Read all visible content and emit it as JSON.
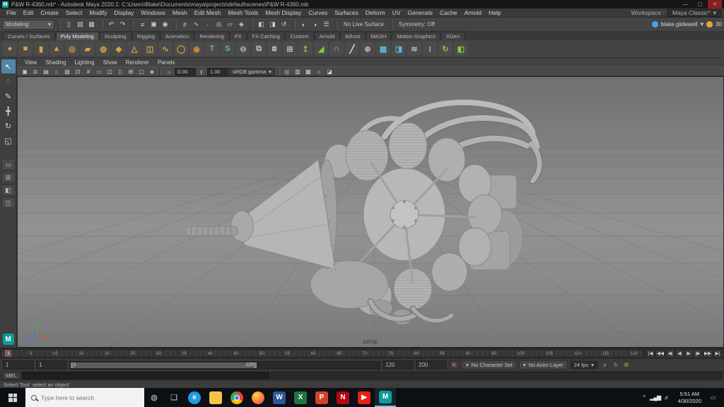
{
  "titlebar": {
    "logo": "M",
    "title": "P&W R-4360.mb* - Autodesk Maya 2020.1: C:\\Users\\Blake\\Documents\\maya\\projects\\default\\scenes\\P&W R-4360.mb",
    "min": "—",
    "max": "▢",
    "close": "✕"
  },
  "menubar": {
    "items": [
      "File",
      "Edit",
      "Create",
      "Select",
      "Modify",
      "Display",
      "Windows",
      "Mesh",
      "Edit Mesh",
      "Mesh Tools",
      "Mesh Display",
      "Curves",
      "Surfaces",
      "Deform",
      "UV",
      "Generate",
      "Cache",
      "Arnold",
      "Help"
    ],
    "workspace_label": "Workspace :",
    "workspace_value": "Maya Classic*",
    "caret": "▾"
  },
  "statusline": {
    "mode": "Modeling",
    "caret": "▾",
    "files": [
      {
        "name": "new-scene-icon",
        "glyph": "▯"
      },
      {
        "name": "open-scene-icon",
        "glyph": "▤"
      },
      {
        "name": "save-scene-icon",
        "glyph": "▦"
      }
    ],
    "undo": [
      {
        "name": "undo-icon",
        "glyph": "↶"
      },
      {
        "name": "redo-icon",
        "glyph": "↷"
      }
    ],
    "masks": [
      {
        "name": "select-by-hierarchy-icon",
        "glyph": "≡"
      },
      {
        "name": "select-by-object-icon",
        "glyph": "▣"
      },
      {
        "name": "select-by-component-icon",
        "glyph": "◉"
      }
    ],
    "snap": [
      {
        "name": "snap-to-grid-icon",
        "glyph": "#"
      },
      {
        "name": "snap-to-curve-icon",
        "glyph": "∿"
      },
      {
        "name": "snap-to-point-icon",
        "glyph": "∙"
      },
      {
        "name": "snap-to-projected-center-icon",
        "glyph": "◎"
      },
      {
        "name": "snap-to-view-plane-icon",
        "glyph": "▱"
      },
      {
        "name": "make-live-icon",
        "glyph": "◈"
      }
    ],
    "history": [
      {
        "name": "inputs-to-selected-icon",
        "glyph": "◧"
      },
      {
        "name": "outputs-from-selected-icon",
        "glyph": "◨"
      },
      {
        "name": "construction-history-icon",
        "glyph": "↺"
      }
    ],
    "render": [
      {
        "name": "render-current-frame-icon",
        "glyph": "◐"
      },
      {
        "name": "ipr-render-icon",
        "glyph": "◑"
      },
      {
        "name": "render-settings-icon",
        "glyph": "☰"
      }
    ],
    "live_surface": "No Live Surface",
    "symmetry": "Symmetry: Off",
    "username": "blake.glidewell",
    "badge": "30"
  },
  "shelf": {
    "tabs": [
      {
        "label": "Curves / Surfaces"
      },
      {
        "label": "Poly Modeling",
        "active": true
      },
      {
        "label": "Sculpting"
      },
      {
        "label": "Rigging"
      },
      {
        "label": "Animation"
      },
      {
        "label": "Rendering"
      },
      {
        "label": "FX"
      },
      {
        "label": "FX Caching"
      },
      {
        "label": "Custom"
      },
      {
        "label": "Arnold"
      },
      {
        "label": "Bifrost"
      },
      {
        "label": "MASH"
      },
      {
        "label": "Motion Graphics"
      },
      {
        "label": "XGen"
      }
    ],
    "icons": [
      {
        "name": "shelf-sphere-icon",
        "glyph": "●",
        "color": "#d9a43e"
      },
      {
        "name": "shelf-cube-icon",
        "glyph": "■",
        "color": "#d9a43e"
      },
      {
        "name": "shelf-cylinder-icon",
        "glyph": "▮",
        "color": "#d9a43e"
      },
      {
        "name": "shelf-cone-icon",
        "glyph": "▲",
        "color": "#d9a43e"
      },
      {
        "name": "shelf-torus-icon",
        "glyph": "◎",
        "color": "#d9a43e"
      },
      {
        "name": "shelf-plane-icon",
        "glyph": "▰",
        "color": "#d9a43e"
      },
      {
        "name": "shelf-disc-icon",
        "glyph": "◍",
        "color": "#d9a43e"
      },
      {
        "name": "shelf-platonic-icon",
        "glyph": "◆",
        "color": "#d9a43e"
      },
      {
        "name": "shelf-pyramid-icon",
        "glyph": "△",
        "color": "#d9a43e"
      },
      {
        "name": "shelf-pipe-icon",
        "glyph": "◫",
        "color": "#d9a43e"
      },
      {
        "name": "shelf-helix-icon",
        "glyph": "∿",
        "color": "#d9a43e"
      },
      {
        "name": "shelf-soccer-ball-icon",
        "glyph": "◯",
        "color": "#d9a43e"
      },
      {
        "name": "shelf-superellipse-icon",
        "glyph": "◉",
        "color": "#cf8a2f"
      },
      {
        "name": "shelf-type-icon",
        "glyph": "T",
        "color": "#5fb4da"
      },
      {
        "name": "shelf-svg-icon",
        "glyph": "S",
        "color": "#5fb4da"
      },
      {
        "name": "shelf-boolean-icon",
        "glyph": "⊖",
        "color": "#b9bcbf"
      },
      {
        "name": "shelf-combine-icon",
        "glyph": "⧉",
        "color": "#b9bcbf"
      },
      {
        "name": "shelf-separate-icon",
        "glyph": "⧈",
        "color": "#b9bcbf"
      },
      {
        "name": "shelf-extract-icon",
        "glyph": "⊞",
        "color": "#b9bcbf"
      },
      {
        "name": "shelf-extrude-icon",
        "glyph": "↥",
        "color": "#8bc34a"
      },
      {
        "name": "shelf-bevel-icon",
        "glyph": "◢",
        "color": "#8bc34a"
      },
      {
        "name": "shelf-bridge-icon",
        "glyph": "∩",
        "color": "#b9bcbf"
      },
      {
        "name": "shelf-multi-cut-icon",
        "glyph": "╱",
        "color": "#e8e8e8"
      },
      {
        "name": "shelf-target-weld-icon",
        "glyph": "⊕",
        "color": "#b9bcbf"
      },
      {
        "name": "shelf-quad-draw-icon",
        "glyph": "▦",
        "color": "#5fb4da"
      },
      {
        "name": "shelf-mirror-icon",
        "glyph": "◨",
        "color": "#5fb4da"
      },
      {
        "name": "shelf-smooth-icon",
        "glyph": "≋",
        "color": "#b9bcbf"
      },
      {
        "name": "shelf-crease-icon",
        "glyph": "≀",
        "color": "#b9bcbf"
      },
      {
        "name": "shelf-spin-edge-icon",
        "glyph": "↻",
        "color": "#8bc34a"
      },
      {
        "name": "shelf-symmetrize-icon",
        "glyph": "◧",
        "color": "#8bc34a"
      }
    ]
  },
  "toolbox": {
    "tools": [
      {
        "name": "select-tool",
        "glyph": "↖",
        "active": true
      },
      {
        "name": "lasso-tool",
        "glyph": "◌"
      },
      {
        "name": "paint-select-tool",
        "glyph": "✎"
      },
      {
        "name": "move-tool",
        "glyph": "╋"
      },
      {
        "name": "rotate-tool",
        "glyph": "↻"
      },
      {
        "name": "scale-tool",
        "glyph": "◱"
      }
    ],
    "layouts": [
      {
        "name": "layout-single-pane-button",
        "glyph": "▭"
      },
      {
        "name": "layout-four-pane-button",
        "glyph": "⊞"
      },
      {
        "name": "layout-persp-outliner-button",
        "glyph": "◧"
      },
      {
        "name": "layout-hypershade-button",
        "glyph": "◫"
      }
    ],
    "logo": "M"
  },
  "panel": {
    "menu": [
      "View",
      "Shading",
      "Lighting",
      "Show",
      "Renderer",
      "Panels"
    ],
    "icons_left": [
      {
        "name": "select-camera-icon",
        "glyph": "▣"
      },
      {
        "name": "lock-camera-icon",
        "glyph": "◘"
      },
      {
        "name": "camera-attributes-icon",
        "glyph": "▤"
      },
      {
        "name": "bookmarks-icon",
        "glyph": "⌂"
      },
      {
        "name": "image-plane-icon",
        "glyph": "▧"
      },
      {
        "name": "two-d-pan-zoom-icon",
        "glyph": "⊡"
      },
      {
        "name": "grid-toggle-icon",
        "glyph": "#"
      },
      {
        "name": "film-gate-icon",
        "glyph": "▭"
      },
      {
        "name": "resolution-gate-icon",
        "glyph": "◫"
      },
      {
        "name": "gate-mask-icon",
        "glyph": "▯"
      },
      {
        "name": "field-chart-icon",
        "glyph": "⊞"
      },
      {
        "name": "safe-action-icon",
        "glyph": "▢"
      },
      {
        "name": "safe-title-icon",
        "glyph": "◈"
      }
    ],
    "exposure_icon": "☼",
    "exposure": "0.00",
    "gamma_icon": "γ",
    "gamma": "1.00",
    "view_transform": "sRGB gamma",
    "caret": "▾",
    "icons_right": [
      {
        "name": "isolate-select-icon",
        "glyph": "◎"
      },
      {
        "name": "xray-icon",
        "glyph": "▥"
      },
      {
        "name": "wireframe-on-shaded-icon",
        "glyph": "▩"
      },
      {
        "name": "lighting-toggle-icon",
        "glyph": "☼"
      },
      {
        "name": "shadows-toggle-icon",
        "glyph": "◪"
      }
    ]
  },
  "viewport": {
    "camera": "persp"
  },
  "timeline": {
    "current": "1",
    "ticks": [
      "1",
      "5",
      "10",
      "15",
      "20",
      "25",
      "30",
      "35",
      "40",
      "45",
      "50",
      "55",
      "60",
      "65",
      "70",
      "75",
      "80",
      "85",
      "90",
      "95",
      "100",
      "105",
      "110",
      "115",
      "120"
    ],
    "playback": [
      {
        "name": "go-to-start-button",
        "glyph": "|◀"
      },
      {
        "name": "step-back-frame-button",
        "glyph": "◀◀"
      },
      {
        "name": "step-back-key-button",
        "glyph": "◀|"
      },
      {
        "name": "play-backward-button",
        "glyph": "◀"
      },
      {
        "name": "play-forward-button",
        "glyph": "▶"
      },
      {
        "name": "step-forward-key-button",
        "glyph": "|▶"
      },
      {
        "name": "step-forward-frame-button",
        "glyph": "▶▶"
      },
      {
        "name": "go-to-end-button",
        "glyph": "▶|"
      }
    ]
  },
  "range": {
    "anim_start": "1",
    "playback_start": "1",
    "bar_start": "1",
    "bar_end": "120",
    "playback_end": "120",
    "anim_end": "200",
    "autokey": "K",
    "char_set": "No Character Set",
    "anim_layer": "No Anim Layer",
    "fps": "24 fps",
    "caret": "▾",
    "extras": [
      {
        "name": "mute-icon",
        "glyph": "♬"
      },
      {
        "name": "loop-icon",
        "glyph": "↻"
      },
      {
        "name": "anim-preferences-icon",
        "glyph": "⚙"
      }
    ]
  },
  "command": {
    "label": "MEL",
    "value": ""
  },
  "help": {
    "text": "Select Tool: select an object"
  },
  "taskbar": {
    "search_placeholder": "Type here to search",
    "apps": [
      {
        "name": "taskbar-edge-icon",
        "glyph": "e",
        "color": "#1e9be2",
        "shape": "circle"
      },
      {
        "name": "taskbar-explorer-icon",
        "glyph": "",
        "color": "#f3c44c"
      },
      {
        "name": "taskbar-chrome-icon",
        "glyph": "",
        "shape": "chrome"
      },
      {
        "name": "taskbar-firefox-icon",
        "glyph": "",
        "shape": "firefox"
      },
      {
        "name": "taskbar-word-icon",
        "glyph": "W",
        "color": "#2b579a"
      },
      {
        "name": "taskbar-excel-icon",
        "glyph": "X",
        "color": "#217346"
      },
      {
        "name": "taskbar-powerpoint-icon",
        "glyph": "P",
        "color": "#d04423"
      },
      {
        "name": "taskbar-netflix-icon",
        "glyph": "N",
        "color": "#b20710"
      },
      {
        "name": "taskbar-youtube-icon",
        "glyph": "▶",
        "color": "#e62117"
      },
      {
        "name": "taskbar-maya-icon",
        "glyph": "M",
        "color": "#0f9b9b",
        "active": true
      }
    ],
    "tray": [
      {
        "name": "hidden-icons-button",
        "glyph": "^"
      },
      {
        "name": "network-icon",
        "glyph": "▂▄▆"
      },
      {
        "name": "volume-icon",
        "glyph": "♬"
      }
    ],
    "time": "5:51 AM",
    "date": "4/30/2020",
    "action_center": [
      {
        "name": "action-center-icon",
        "glyph": "▭"
      }
    ]
  }
}
